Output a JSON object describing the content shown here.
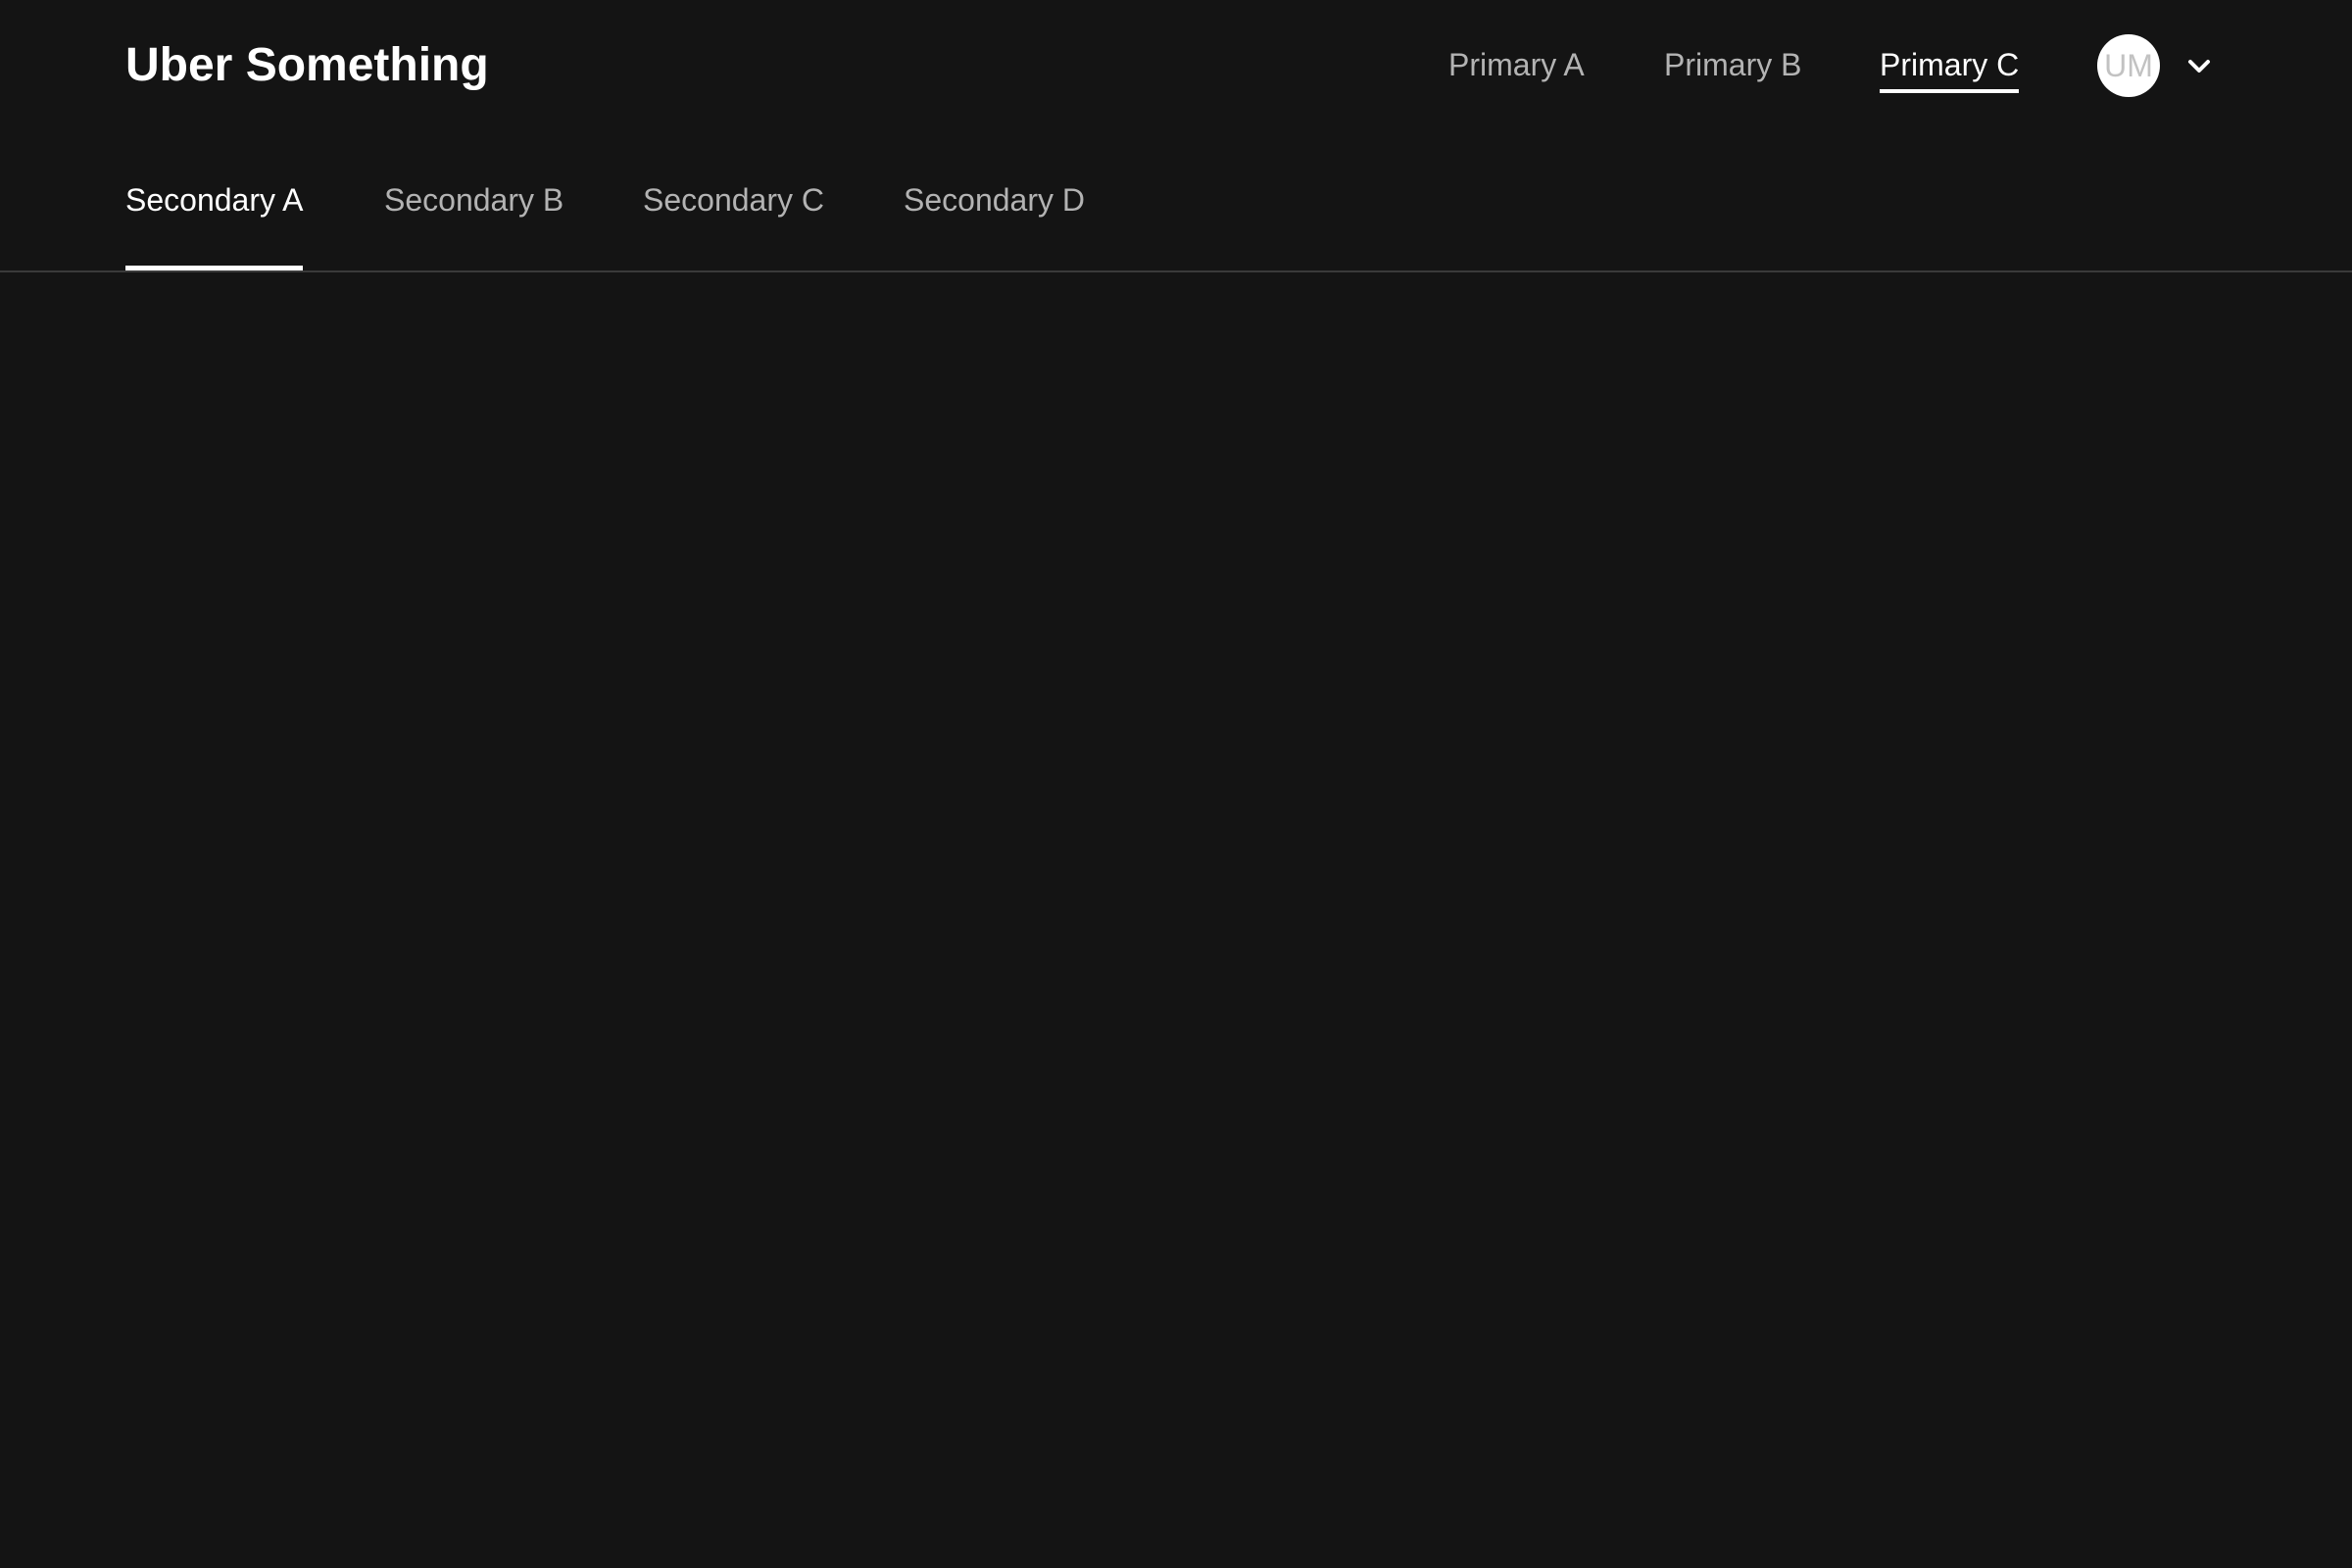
{
  "header": {
    "title": "Uber Something"
  },
  "primary_nav": {
    "items": [
      {
        "label": "Primary A",
        "active": false
      },
      {
        "label": "Primary B",
        "active": false
      },
      {
        "label": "Primary C",
        "active": true
      }
    ]
  },
  "user": {
    "initials": "UM",
    "menu_icon": "chevron-down-icon"
  },
  "secondary_nav": {
    "items": [
      {
        "label": "Secondary A",
        "active": true
      },
      {
        "label": "Secondary B",
        "active": false
      },
      {
        "label": "Secondary C",
        "active": false
      },
      {
        "label": "Secondary D",
        "active": false
      }
    ]
  },
  "colors": {
    "background": "#141414",
    "text_primary": "#ffffff",
    "text_muted": "#b3b3b3",
    "divider": "#3a3a3a"
  }
}
